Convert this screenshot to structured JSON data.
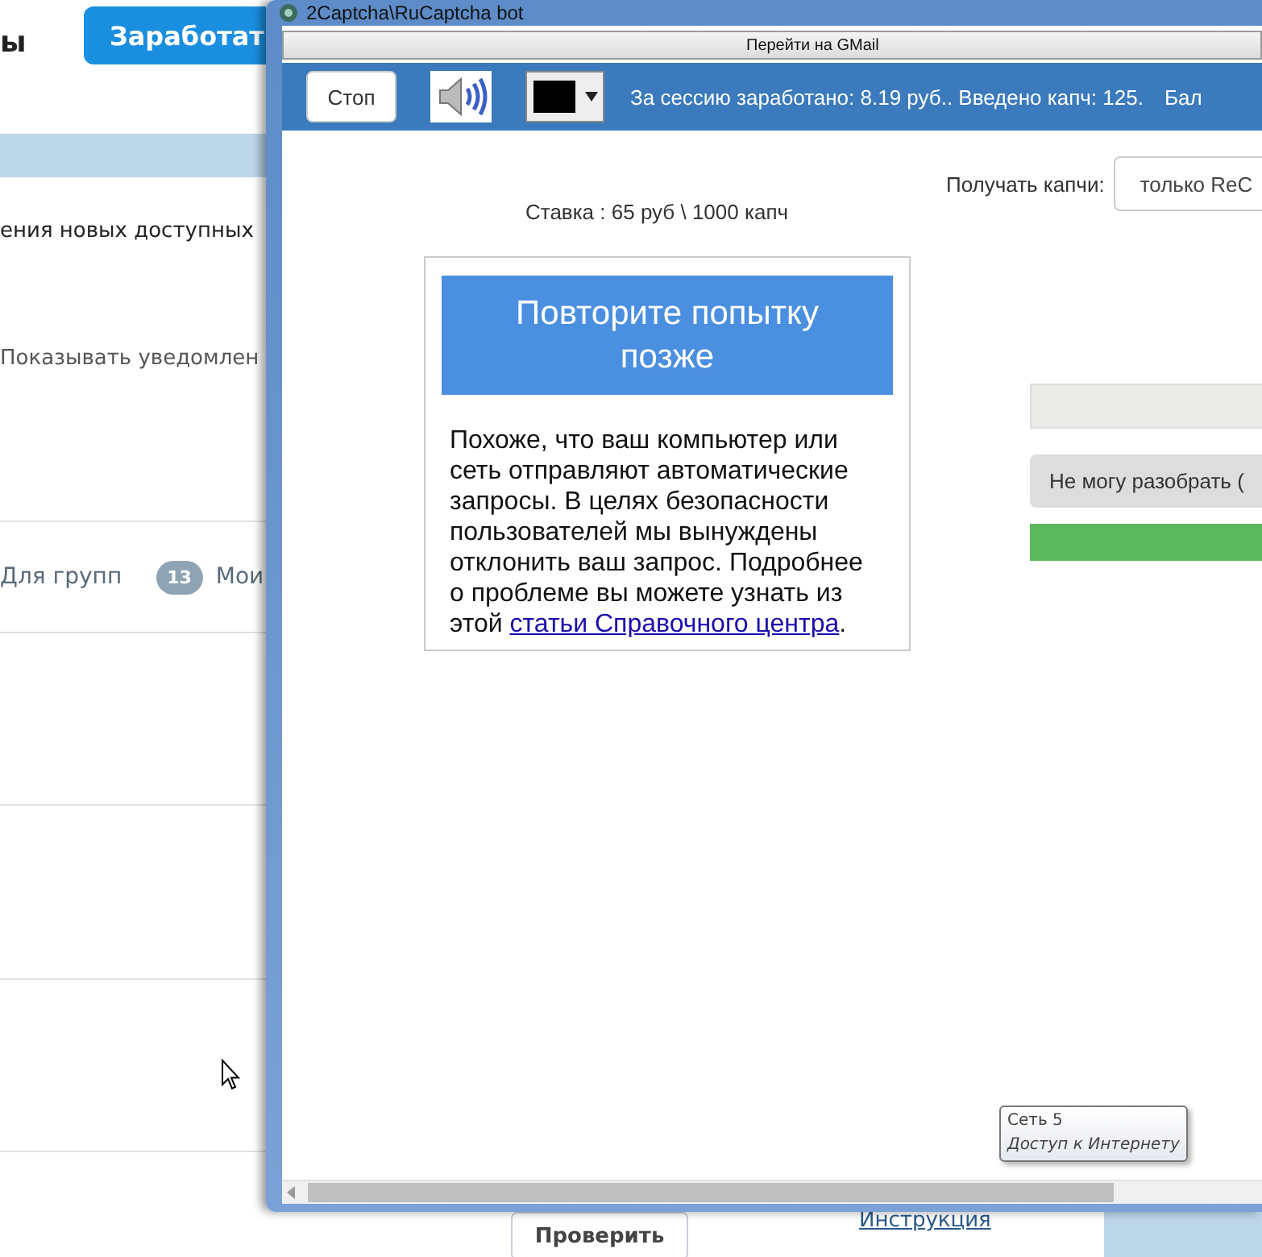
{
  "background_page": {
    "heading_fragment": "ы",
    "earn_button": "Заработат",
    "section_title": "ения новых доступных",
    "notification_option": "Показывать уведомлен",
    "tabs": [
      {
        "label": "Для групп"
      },
      {
        "badge": "13",
        "label": "Мои"
      }
    ],
    "check_button": "Проверить",
    "instruction_link": "Инструкция"
  },
  "window": {
    "title": "2Captcha\\RuCaptcha bot",
    "gmail_button": "Перейти на GMail",
    "stop_button": "Стоп",
    "session_info": "За сессию заработано: 8.19 руб.. Введено капч: 125.",
    "balance_fragment": "Бал",
    "rate": "Ставка : 65 руб \\ 1000 капч",
    "receive_label": "Получать капчи:",
    "receive_select": "только ReC",
    "error_card": {
      "title": "Повторите попытку позже",
      "body": "Похоже, что ваш компьютер или сеть отправляют автоматические запросы. В целях безопасности пользователей мы вынуждены отклонить ваш запрос. Подробнее о проблеме вы можете узнать из этой ",
      "link": "статьи Справочного центра",
      "body_end": "."
    },
    "cannot_read_button": "Не могу разобрать ("
  },
  "tooltip": {
    "network": "Сеть  5",
    "access": "Доступ к Интернету"
  }
}
